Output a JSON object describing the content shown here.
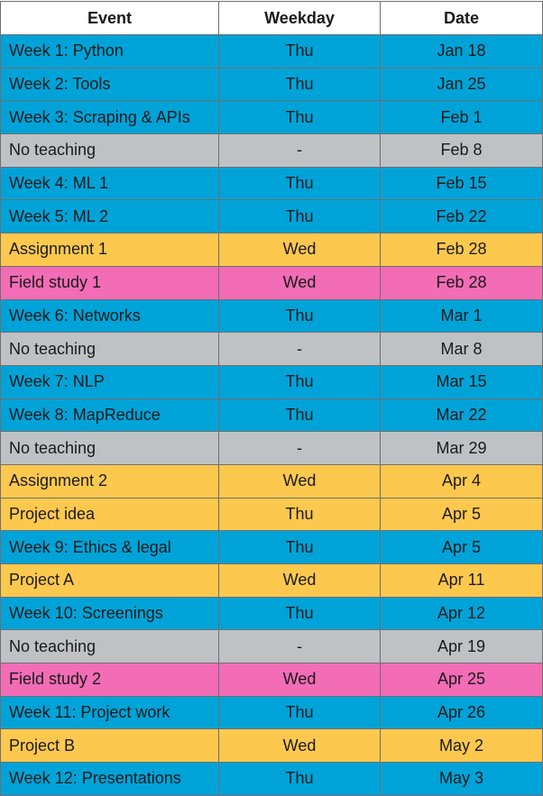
{
  "table": {
    "headers": {
      "event": "Event",
      "weekday": "Weekday",
      "date": "Date"
    },
    "category_colors": {
      "teaching": "#00a3d8",
      "none": "#bec2c5",
      "deadline": "#fdc84e",
      "field": "#f26cb6"
    },
    "rows": [
      {
        "event": "Week 1: Python",
        "weekday": "Thu",
        "date": "Jan 18",
        "category": "teaching"
      },
      {
        "event": "Week 2: Tools",
        "weekday": "Thu",
        "date": "Jan 25",
        "category": "teaching"
      },
      {
        "event": "Week 3: Scraping & APIs",
        "weekday": "Thu",
        "date": "Feb 1",
        "category": "teaching"
      },
      {
        "event": "No teaching",
        "weekday": "-",
        "date": "Feb 8",
        "category": "none"
      },
      {
        "event": "Week 4: ML 1",
        "weekday": "Thu",
        "date": "Feb 15",
        "category": "teaching"
      },
      {
        "event": "Week 5: ML 2",
        "weekday": "Thu",
        "date": "Feb 22",
        "category": "teaching"
      },
      {
        "event": "Assignment 1",
        "weekday": "Wed",
        "date": "Feb 28",
        "category": "deadline"
      },
      {
        "event": "Field study 1",
        "weekday": "Wed",
        "date": "Feb 28",
        "category": "field"
      },
      {
        "event": "Week 6: Networks",
        "weekday": "Thu",
        "date": "Mar 1",
        "category": "teaching"
      },
      {
        "event": "No teaching",
        "weekday": "-",
        "date": "Mar 8",
        "category": "none"
      },
      {
        "event": "Week 7: NLP",
        "weekday": "Thu",
        "date": "Mar 15",
        "category": "teaching"
      },
      {
        "event": "Week 8: MapReduce",
        "weekday": "Thu",
        "date": "Mar 22",
        "category": "teaching"
      },
      {
        "event": "No teaching",
        "weekday": "-",
        "date": "Mar 29",
        "category": "none"
      },
      {
        "event": "Assignment 2",
        "weekday": "Wed",
        "date": "Apr 4",
        "category": "deadline"
      },
      {
        "event": "Project idea",
        "weekday": "Thu",
        "date": "Apr 5",
        "category": "deadline"
      },
      {
        "event": "Week 9: Ethics & legal",
        "weekday": "Thu",
        "date": "Apr 5",
        "category": "teaching"
      },
      {
        "event": "Project A",
        "weekday": "Wed",
        "date": "Apr 11",
        "category": "deadline"
      },
      {
        "event": "Week 10: Screenings",
        "weekday": "Thu",
        "date": "Apr 12",
        "category": "teaching"
      },
      {
        "event": "No teaching",
        "weekday": "-",
        "date": "Apr 19",
        "category": "none"
      },
      {
        "event": "Field study 2",
        "weekday": "Wed",
        "date": "Apr 25",
        "category": "field"
      },
      {
        "event": "Week 11: Project work",
        "weekday": "Thu",
        "date": "Apr 26",
        "category": "teaching"
      },
      {
        "event": "Project B",
        "weekday": "Wed",
        "date": "May 2",
        "category": "deadline"
      },
      {
        "event": "Week 12: Presentations",
        "weekday": "Thu",
        "date": "May 3",
        "category": "teaching"
      }
    ]
  }
}
